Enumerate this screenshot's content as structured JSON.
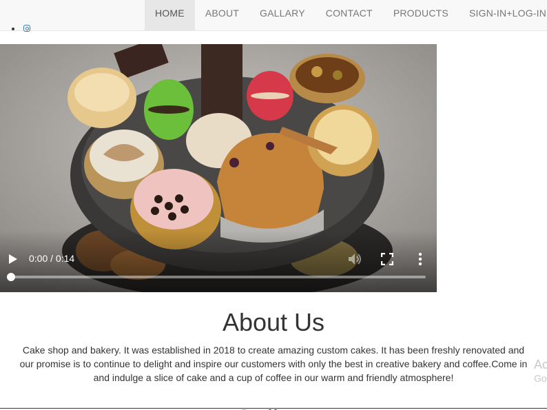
{
  "nav": {
    "items": [
      {
        "label": "HOME",
        "active": true
      },
      {
        "label": "ABOUT",
        "active": false
      },
      {
        "label": "GALLARY",
        "active": false
      },
      {
        "label": "CONTACT",
        "active": false
      },
      {
        "label": "PRODUCTS",
        "active": false
      },
      {
        "label": "SIGN-IN+LOG-IN",
        "active": false
      }
    ]
  },
  "social": {
    "icons": [
      "bullet-icon",
      "instagram-icon"
    ]
  },
  "video": {
    "current_time": "0:00",
    "duration": "0:14",
    "time_display": "0:00 / 0:14",
    "progress_fraction": 0.0,
    "icons": [
      "play-icon",
      "volume-icon",
      "fullscreen-icon",
      "more-options-icon"
    ]
  },
  "about": {
    "title": "About Us",
    "body": "Cake shop and bakery. It was established in 2018 to create amazing custom cakes. It has been freshly renovated and our promise is to continue to delight and inspire our customers with only the best in creative bakery and coffee.Come in and indulge a slice of cake and a cup of coffee in our warm and friendly atmosphere!"
  },
  "side_overlay": {
    "line1": "Ac",
    "line2": "Go"
  },
  "next_section": {
    "title": "Gallery"
  },
  "colors": {
    "nav_bg": "#f8f8f8",
    "nav_active": "#e7e7e7",
    "link_blue": "#337ab7"
  }
}
